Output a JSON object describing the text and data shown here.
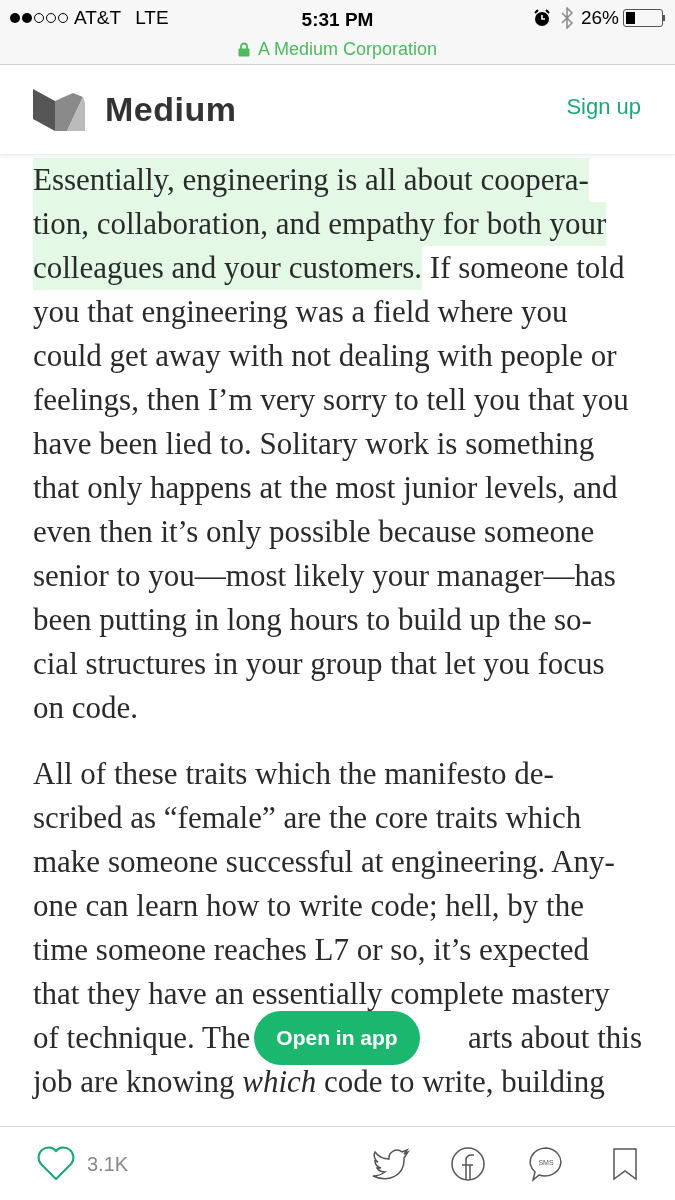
{
  "status_bar": {
    "signal_dots": [
      {
        "filled": true
      },
      {
        "filled": true
      },
      {
        "filled": false
      },
      {
        "filled": false
      },
      {
        "filled": false
      }
    ],
    "carrier": "AT&T",
    "network": "LTE",
    "time": "5:31 PM",
    "battery_text": "26%",
    "battery": {
      "level": 0.26
    }
  },
  "address_bar": {
    "site": "A Medium Corporation"
  },
  "header": {
    "brand": "Medium",
    "sign_up": "Sign up"
  },
  "article": {
    "paragraphs": [
      {
        "lines": [
          [
            {
              "text": "Essentially, engineering is all about coopera-",
              "highlighted": true
            }
          ],
          [
            {
              "text": "tion, collaboration, and empathy for both your",
              "highlighted": true
            }
          ],
          [
            {
              "text": "colleagues and your customers.",
              "highlighted": true
            },
            {
              "text": " If someone told",
              "highlighted": false
            }
          ],
          [
            {
              "text": "you that engineering was a field where you",
              "highlighted": false
            }
          ],
          [
            {
              "text": "could get away with not dealing with people or",
              "highlighted": false
            }
          ],
          [
            {
              "text": "feelings, then I’m very sorry to tell you that you",
              "highlighted": false
            }
          ],
          [
            {
              "text": "have been lied to. Solitary work is something",
              "highlighted": false
            }
          ],
          [
            {
              "text": "that only happens at the most junior levels, and",
              "highlighted": false
            }
          ],
          [
            {
              "text": "even then it’s only possible because someone",
              "highlighted": false
            }
          ],
          [
            {
              "text": "senior to you—most likely your manager—has",
              "highlighted": false
            }
          ],
          [
            {
              "text": "been putting in long hours to build up the so-",
              "highlighted": false
            }
          ],
          [
            {
              "text": "cial structures in your group that let you focus",
              "highlighted": false
            }
          ],
          [
            {
              "text": "on code.",
              "highlighted": false
            }
          ]
        ]
      },
      {
        "lines": [
          [
            {
              "text": "All of these traits which the manifesto de-",
              "highlighted": false
            }
          ],
          [
            {
              "text": "scribed as “female” are the core traits which",
              "highlighted": false
            }
          ],
          [
            {
              "text": "make someone successful at engineering. Any-",
              "highlighted": false
            }
          ],
          [
            {
              "text": "one can learn how to write code; hell, by the",
              "highlighted": false
            }
          ],
          [
            {
              "text": "time someone reaches L7 or so, it’s expected",
              "highlighted": false
            }
          ],
          [
            {
              "text": "that they have an essentially complete mastery",
              "highlighted": false
            }
          ],
          [
            {
              "text": "of technique. The",
              "highlighted": false
            },
            {
              "text": "arts about this",
              "highlighted": false
            }
          ],
          [
            {
              "text": "job are knowing *which* code to write, building",
              "highlighted": false
            }
          ]
        ]
      }
    ]
  },
  "open_in_app": "Open in app",
  "bottom_bar": {
    "likes": "3.1K",
    "liked": false,
    "sms_label": "SMS"
  }
}
